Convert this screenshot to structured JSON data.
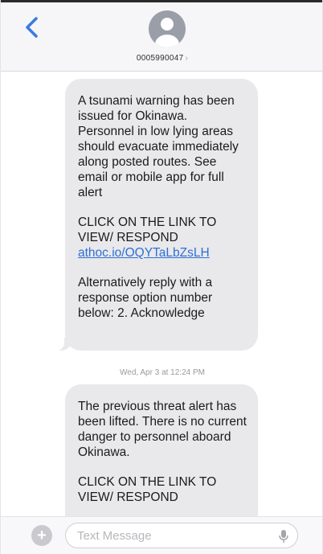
{
  "header": {
    "contact_number": "0005990047",
    "chevron": "›"
  },
  "messages": [
    {
      "paragraph1": "A tsunami warning has been issued for Okinawa.  Personnel in low lying areas should evacuate immediately along posted routes.  See email or mobile app for full alert",
      "paragraph2": "CLICK ON THE LINK TO VIEW/ RESPOND",
      "link": "athoc.io/OQYTaLbZsLH",
      "paragraph3": "Alternatively reply with a response option number below: 2. Acknowledge"
    },
    {
      "paragraph1": "The previous threat alert has been lifted.  There is no current danger to personnel aboard Okinawa.",
      "paragraph2": "CLICK ON THE LINK TO VIEW/ RESPOND"
    }
  ],
  "timestamp": "Wed, Apr 3 at 12:24 PM",
  "composer": {
    "plus_label": "+",
    "placeholder": "Text Message"
  },
  "icons": {
    "back": "chevron-left-icon",
    "avatar": "person-silhouette-icon",
    "add": "plus-icon",
    "mic": "microphone-icon"
  },
  "colors": {
    "accent": "#2f6fd6",
    "bubble": "#e9e9eb",
    "header": "#f6f6f8"
  }
}
